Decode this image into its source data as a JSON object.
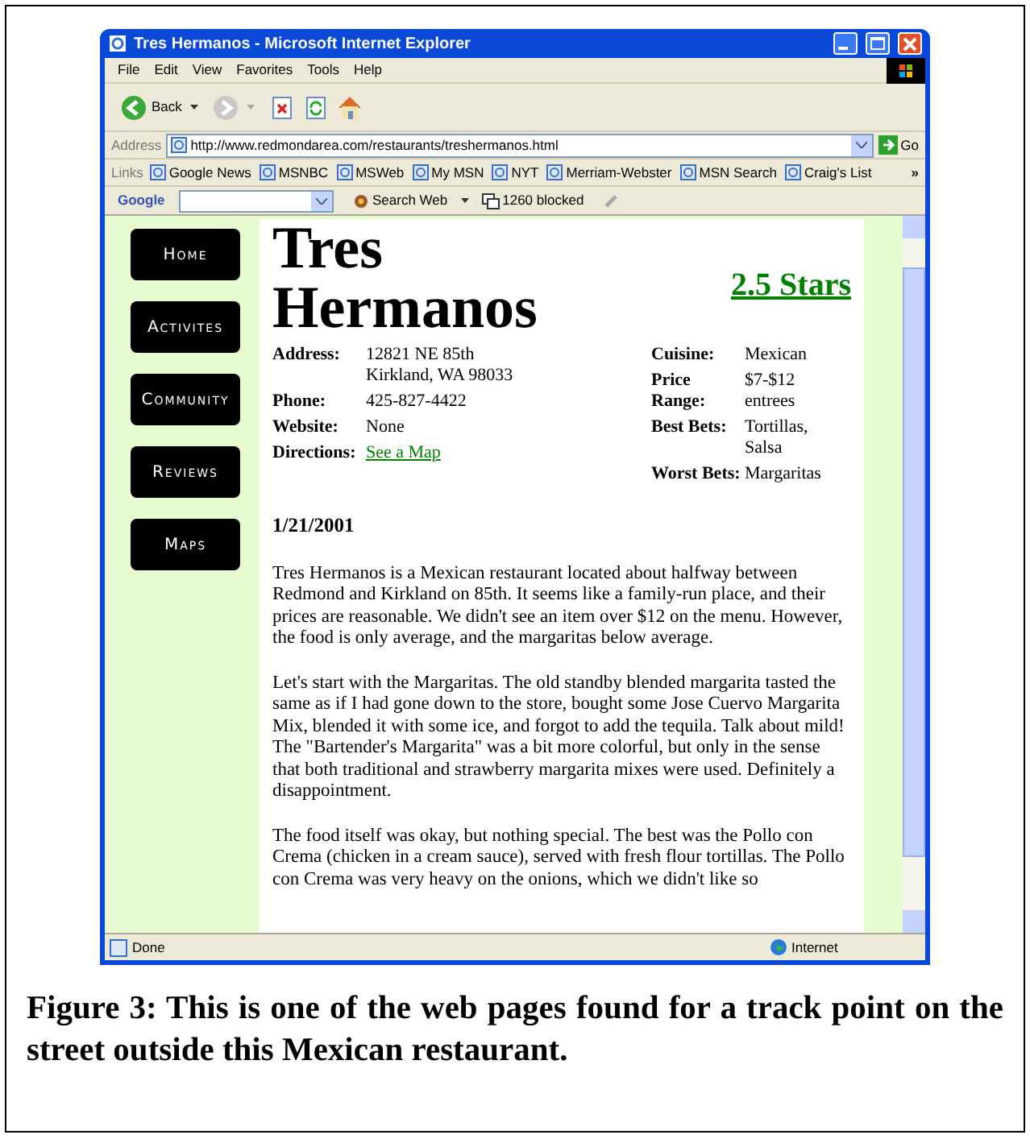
{
  "window": {
    "title": "Tres Hermanos - Microsoft Internet Explorer"
  },
  "menu": [
    "File",
    "Edit",
    "View",
    "Favorites",
    "Tools",
    "Help"
  ],
  "toolbar": {
    "back": "Back"
  },
  "address": {
    "label": "Address",
    "url": "http://www.redmondarea.com/restaurants/treshermanos.html",
    "go": "Go"
  },
  "links": {
    "label": "Links",
    "items": [
      "Google News",
      "MSNBC",
      "MSWeb",
      "My MSN",
      "NYT",
      "Merriam-Webster",
      "MSN Search",
      "Craig's List"
    ],
    "more": "»"
  },
  "google_bar": {
    "logo": "Google",
    "search": "Search Web",
    "blocked": "1260 blocked"
  },
  "nav": [
    "Home",
    "Activites",
    "Community",
    "Reviews",
    "Maps"
  ],
  "page": {
    "title": "Tres Hermanos",
    "rating": "2.5 Stars",
    "details_left": [
      {
        "label": "Address:",
        "value": "12821 NE 85th\nKirkland, WA 98033"
      },
      {
        "label": "Phone:",
        "value": "425-827-4422"
      },
      {
        "label": "Website:",
        "value": "None"
      },
      {
        "label": "Directions:",
        "value": "See a Map",
        "kind": "link"
      }
    ],
    "details_right": [
      {
        "label": "Cuisine:",
        "value": "Mexican"
      },
      {
        "label": "Price Range:",
        "value": "$7-$12 entrees"
      },
      {
        "label": "Best Bets:",
        "value": "Tortillas, Salsa"
      },
      {
        "label": "Worst Bets:",
        "value": "Margaritas"
      }
    ],
    "date": "1/21/2001",
    "paragraphs": [
      "Tres Hermanos is a Mexican restaurant located about halfway between Redmond and Kirkland on 85th. It seems like a family-run place, and their prices are reasonable. We didn't see an item over $12 on the menu. However, the food is only average, and the margaritas below average.",
      "Let's start with the Margaritas. The old standby blended margarita tasted the same as if I had gone down to the store, bought some Jose Cuervo Margarita Mix, blended it with some ice, and forgot to add the tequila. Talk about mild! The \"Bartender's Margarita\" was a bit more colorful, but only in the sense that both traditional and strawberry margarita mixes were used. Definitely a disappointment.",
      "The food itself was okay, but nothing special. The best was the Pollo con Crema (chicken in a cream sauce), served with fresh flour tortillas. The Pollo con Crema was very heavy on the onions, which we didn't like so"
    ]
  },
  "status_bar": {
    "text": "Done",
    "zone": "Internet"
  },
  "caption": "Figure 3: This is one of the web pages found for a track point on the street outside this Mexican restaurant."
}
